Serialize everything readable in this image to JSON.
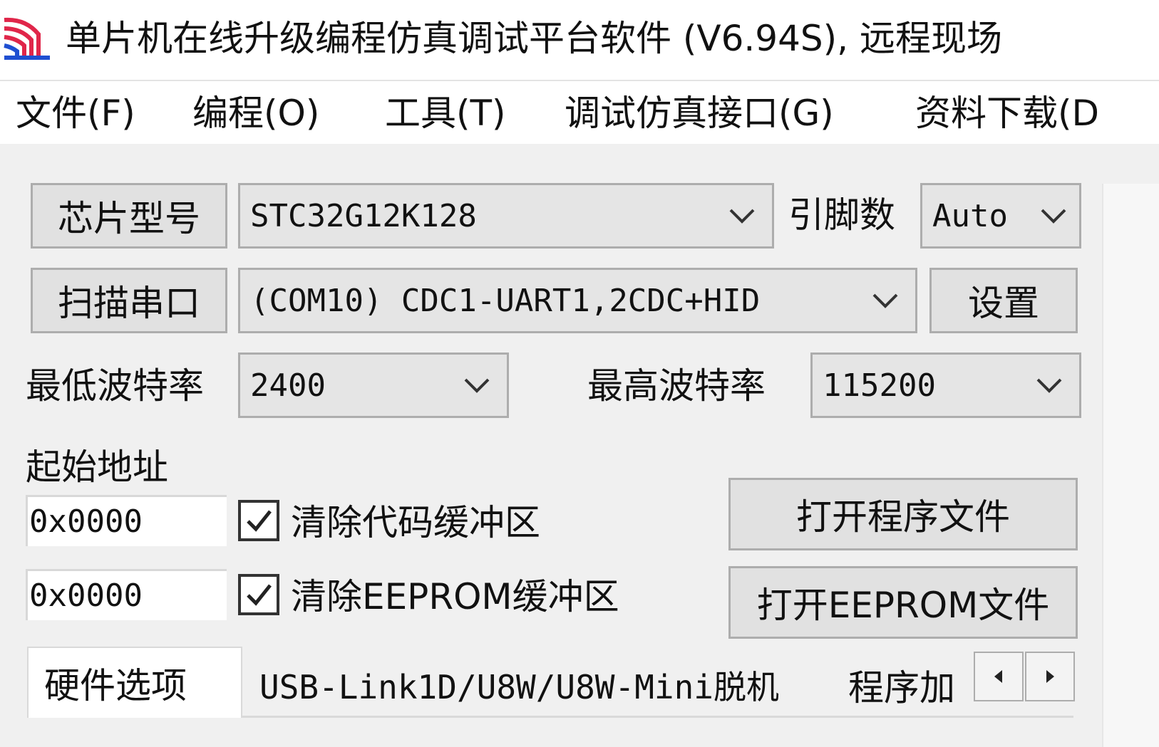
{
  "window": {
    "title": "单片机在线升级编程仿真调试平台软件 (V6.94S), 远程现场"
  },
  "menu": [
    {
      "label": "文件(F)"
    },
    {
      "label": "编程(O)"
    },
    {
      "label": "工具(T)"
    },
    {
      "label": "调试仿真接口(G)"
    },
    {
      "label": "资料下载(D"
    }
  ],
  "chip": {
    "button_label": "芯片型号",
    "model": "STC32G12K128",
    "pins_label": "引脚数",
    "pins_value": "Auto"
  },
  "port": {
    "scan_button_label": "扫描串口",
    "value": "(COM10) CDC1-UART1,2CDC+HID",
    "settings_button_label": "设置"
  },
  "baud": {
    "min_label": "最低波特率",
    "min_value": "2400",
    "max_label": "最高波特率",
    "max_value": "115200"
  },
  "start_address": {
    "label": "起始地址",
    "code_address": "0x0000",
    "eeprom_address": "0x0000"
  },
  "options": {
    "clear_code_label": "清除代码缓冲区",
    "clear_code_checked": true,
    "clear_eeprom_label": "清除EEPROM缓冲区",
    "clear_eeprom_checked": true
  },
  "file_buttons": {
    "open_program": "打开程序文件",
    "open_eeprom": "打开EEPROM文件"
  },
  "tabs": [
    {
      "label": "硬件选项",
      "active": true
    },
    {
      "label": "USB-Link1D/U8W/U8W-Mini脱机",
      "active": false
    },
    {
      "label": "程序加",
      "active": false
    }
  ],
  "icons": {
    "app": "stc-logo-icon",
    "dropdown": "chevron-down-icon",
    "check": "checkmark-icon",
    "scroll_left": "triangle-left-icon",
    "scroll_right": "triangle-right-icon"
  },
  "colors": {
    "logo_red": "#e0264a",
    "logo_blue": "#1f4fd1",
    "button_face": "#e1e1e1",
    "border": "#adadad"
  }
}
